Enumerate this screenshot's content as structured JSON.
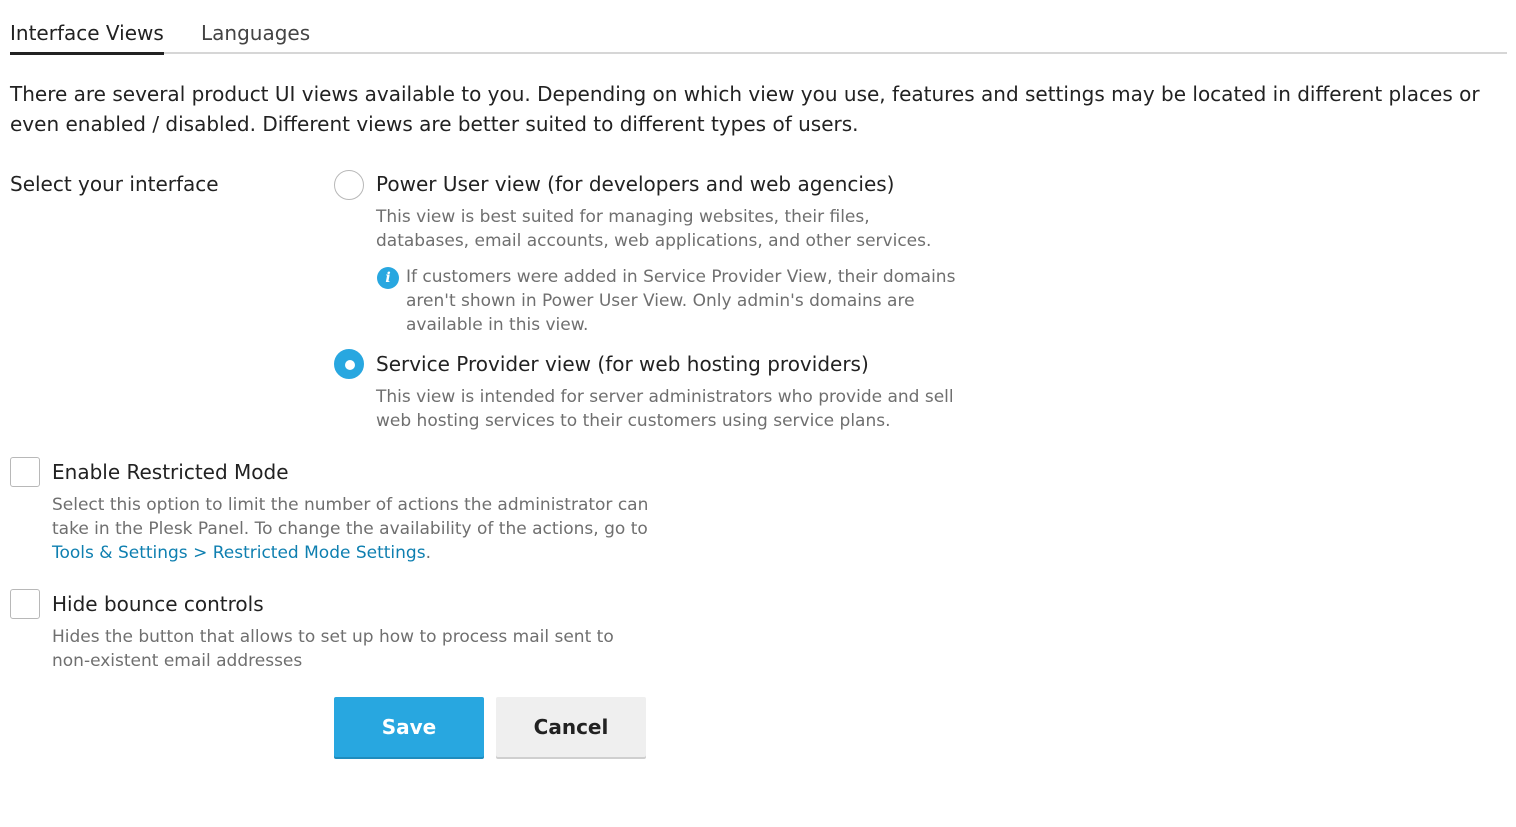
{
  "tabs": [
    {
      "label": "Interface Views",
      "active": true
    },
    {
      "label": "Languages",
      "active": false
    }
  ],
  "intro": "There are several product UI views available to you. Depending on which view you use, features and settings may be located in different places or even enabled / disabled. Different views are better suited to different types of users.",
  "interface": {
    "label": "Select your interface",
    "options": [
      {
        "title": "Power User view (for developers and web agencies)",
        "description": "This view is best suited for managing websites, their files, databases, email accounts, web applications, and other services.",
        "hint": "If customers were added in Service Provider View, their domains aren't shown in Power User View. Only admin's domains are available in this view.",
        "checked": false
      },
      {
        "title": "Service Provider view (for web hosting providers)",
        "description": "This view is intended for server administrators who provide and sell web hosting services to their customers using service plans.",
        "checked": true
      }
    ]
  },
  "restricted_mode": {
    "label": "Enable Restricted Mode",
    "description": "Select this option to limit the number of actions the administrator can take in the Plesk Panel. To change the availability of the actions, go to",
    "link_text": "Tools & Settings > Restricted Mode Settings",
    "after_link": ".",
    "checked": false
  },
  "bounce_controls": {
    "label": "Hide bounce controls",
    "description": "Hides the button that allows to set up how to process mail sent to non-existent email addresses",
    "checked": false
  },
  "buttons": {
    "save": "Save",
    "cancel": "Cancel"
  },
  "icons": {
    "info": "info-icon"
  },
  "colors": {
    "accent": "#28a7e0",
    "link": "#0e7fb0"
  }
}
